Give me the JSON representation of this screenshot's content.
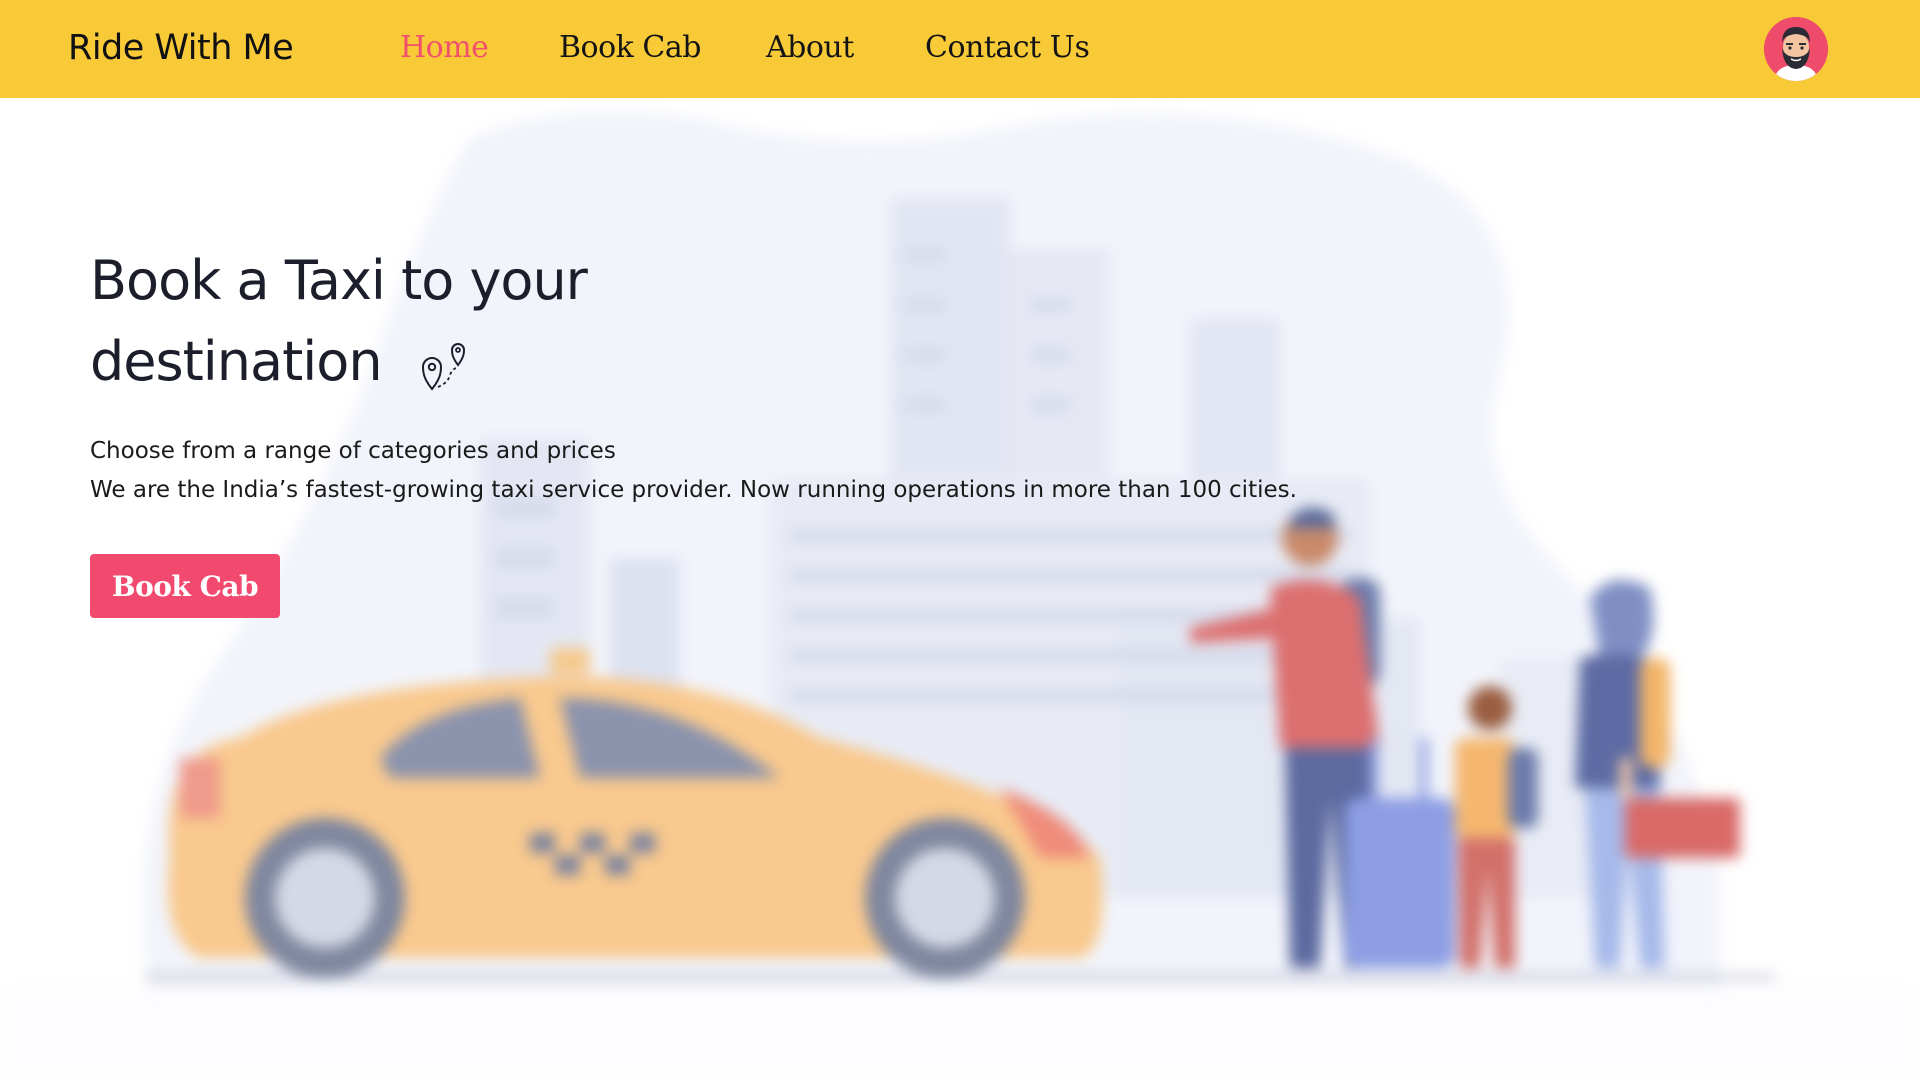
{
  "app": {
    "brand": "Ride With Me"
  },
  "nav": {
    "items": [
      {
        "label": "Home",
        "active": true
      },
      {
        "label": "Book Cab",
        "active": false
      },
      {
        "label": "About",
        "active": false
      },
      {
        "label": "Contact Us",
        "active": false
      }
    ]
  },
  "hero": {
    "title_line1": "Book a Taxi to your",
    "title_line2": "destination",
    "desc_line1": "Choose from a range of categories and prices",
    "desc_line2": "We are the India’s fastest-growing taxi service provider. Now running operations in more than 100 cities.",
    "cta_label": "Book Cab"
  },
  "icons": {
    "title_icon": "route-pins-icon",
    "avatar": "bearded-man-avatar"
  },
  "colors": {
    "navbar": "#f9ca37",
    "accent": "#f2496f",
    "text_dark": "#1c1f2b"
  }
}
